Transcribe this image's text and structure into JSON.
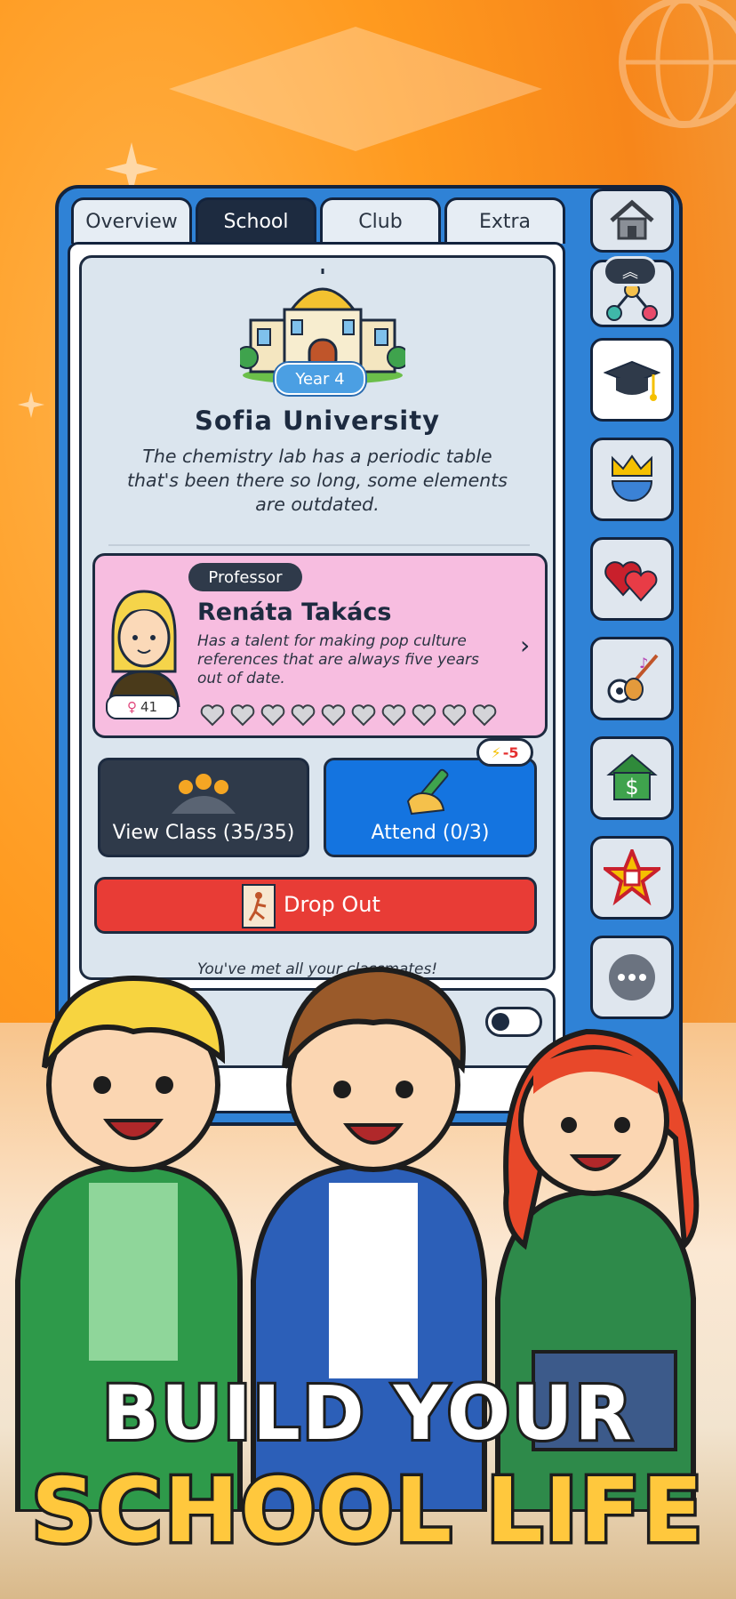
{
  "tabs": [
    {
      "label": "Overview",
      "active": false
    },
    {
      "label": "School",
      "active": true
    },
    {
      "label": "Club",
      "active": false
    },
    {
      "label": "Extra",
      "active": false
    }
  ],
  "school": {
    "year_badge": "Year 4",
    "name": "Sofia University",
    "description": "The chemistry lab has a periodic table that's been there so long, some elements are outdated."
  },
  "professor": {
    "badge": "Professor",
    "name": "Renáta Takács",
    "description": "Has a talent for making pop culture references that are always five years out of date.",
    "gender_symbol": "♀",
    "age": "41",
    "hearts_filled": 0,
    "hearts_total": 10
  },
  "actions": {
    "view_class_label": "View Class (35/35)",
    "attend_label": "Attend (0/3)",
    "energy_cost": "-5",
    "drop_out_label": "Drop Out"
  },
  "footer_note": "You've met all your classmates!",
  "sidebar": [
    {
      "name": "home-icon"
    },
    {
      "name": "network-icon"
    },
    {
      "name": "graduation-cap-icon"
    },
    {
      "name": "crown-globe-icon"
    },
    {
      "name": "hearts-icon"
    },
    {
      "name": "hobbies-icon"
    },
    {
      "name": "house-money-icon"
    },
    {
      "name": "star-trophy-icon"
    },
    {
      "name": "more-icon"
    }
  ],
  "tagline": {
    "line1": "BUILD YOUR",
    "line2": "SCHOOL LIFE"
  },
  "colors": {
    "panel_blue": "#2f82d6",
    "tab_active": "#1d2b40",
    "attend_blue": "#1474e0",
    "drop_red": "#e83c36",
    "professor_pink": "#f7bde0",
    "tagline_yellow": "#ffc83d"
  }
}
